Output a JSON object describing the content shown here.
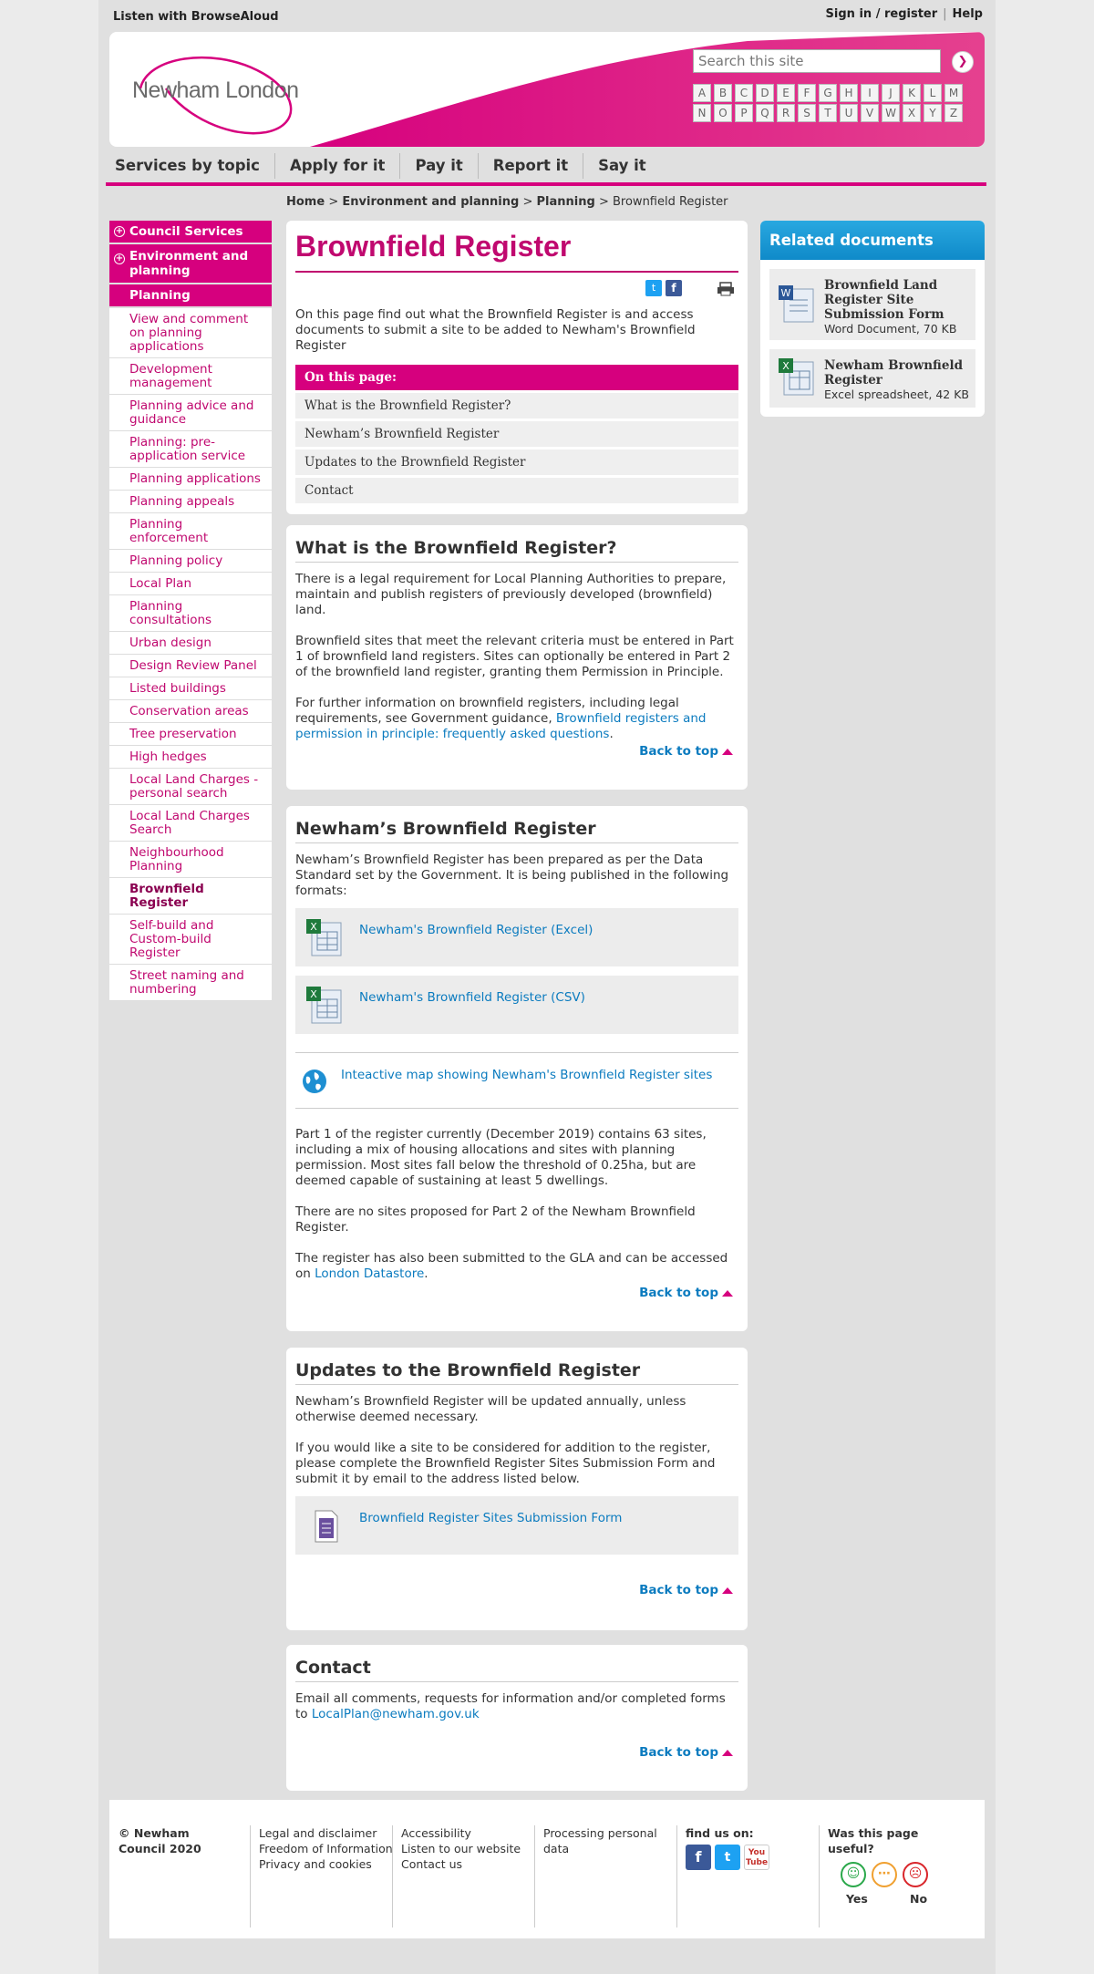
{
  "topbar": {
    "browsealoud": "Listen with BrowseAloud",
    "signin": "Sign in / register",
    "help": "Help"
  },
  "header": {
    "logo_text": "Newham London",
    "search_placeholder": "Search this site",
    "az_row1": [
      "A",
      "B",
      "C",
      "D",
      "E",
      "F",
      "G",
      "H",
      "I",
      "J",
      "K",
      "L",
      "M"
    ],
    "az_row2": [
      "N",
      "O",
      "P",
      "Q",
      "R",
      "S",
      "T",
      "U",
      "V",
      "W",
      "X",
      "Y",
      "Z"
    ]
  },
  "nav": [
    "Services by topic",
    "Apply for it",
    "Pay it",
    "Report it",
    "Say it"
  ],
  "breadcrumb": {
    "home": "Home",
    "env": "Environment and planning",
    "planning": "Planning",
    "current": "Brownfield Register",
    "sep": ">"
  },
  "sidebar": {
    "heads": [
      "Council Services",
      "Environment and planning"
    ],
    "section": "Planning",
    "items": [
      "View and comment on planning applications",
      "Development management",
      "Planning advice and guidance",
      "Planning: pre-application service",
      "Planning applications",
      "Planning appeals",
      "Planning enforcement",
      "Planning policy",
      "Local Plan",
      "Planning consultations",
      "Urban design",
      "Design Review Panel",
      "Listed buildings",
      "Conservation areas",
      "Tree preservation",
      "High hedges",
      "Local Land Charges - personal search",
      "Local Land Charges Search",
      "Neighbourhood Planning",
      "Brownfield Register",
      "Self-build and Custom-build Register",
      "Street naming and numbering"
    ]
  },
  "intro": {
    "title": "Brownfield Register",
    "text": "On this page find out what the Brownfield Register is and access documents to submit a site to be added to Newham's Brownfield Register",
    "on_this_page": "On this page:",
    "links": [
      "What is the Brownfield Register?",
      "Newham’s Brownfield Register",
      "Updates to the Brownfield Register",
      "Contact"
    ]
  },
  "what": {
    "heading": "What is the Brownfield Register?",
    "p1": "There is a legal requirement for Local Planning Authorities to prepare, maintain and publish registers of previously developed (brownfield) land.",
    "p2": "Brownfield sites that meet the relevant criteria must be entered in Part 1 of brownfield land registers. Sites can optionally be entered in Part 2 of the brownfield land register, granting them Permission in Principle.",
    "p3_pre": "For further information on brownfield registers, including legal requirements, see Government guidance, ",
    "p3_link": "Brownfield registers and permission in principle: frequently asked questions",
    "p3_post": "."
  },
  "newham": {
    "heading": "Newham’s Brownfield Register",
    "p1": "Newham’s Brownfield Register has been prepared as per the Data Standard set by the Government. It is being published in the following formats:",
    "doc_excel": "Newham's Brownfield Register (Excel)",
    "doc_csv": "Newham's Brownfield Register (CSV)",
    "map_link": "Inteactive map showing Newham's Brownfield Register sites",
    "p2": "Part 1 of the register currently (December 2019) contains 63 sites, including a mix of housing allocations and sites with planning permission. Most sites fall below the threshold of 0.25ha, but are deemed capable of sustaining at least 5 dwellings.",
    "p3": "There are no sites proposed for Part 2 of the Newham Brownfield Register.",
    "p4_pre": "The register has also been submitted to the GLA and can be accessed on ",
    "p4_link": "London Datastore",
    "p4_post": "."
  },
  "updates": {
    "heading": "Updates to the Brownfield Register",
    "p1": "Newham’s Brownfield Register will be updated annually, unless otherwise deemed necessary.",
    "p2": "If you would like a site to be considered for addition to the register, please complete the Brownfield Register Sites Submission Form and submit it by email to the address listed below.",
    "doc": "Brownfield Register Sites Submission Form"
  },
  "contact": {
    "heading": "Contact",
    "p_pre": "Email all comments, requests for information and/or completed forms to ",
    "email": "LocalPlan@newham.gov.uk"
  },
  "back_to_top": "Back to top",
  "related": {
    "heading": "Related documents",
    "items": [
      {
        "title": "Brownfield Land Register Site Submission Form",
        "meta": "Word Document, 70 KB"
      },
      {
        "title": "Newham Brownfield Register",
        "meta": "Excel spreadsheet, 42 KB"
      }
    ]
  },
  "footer": {
    "copyright": "© Newham Council 2020",
    "col2": [
      "Legal and disclaimer",
      "Freedom of Information",
      "Privacy and cookies"
    ],
    "col3": [
      "Accessibility",
      "Listen to our website",
      "Contact us"
    ],
    "col4": "Processing personal data",
    "find_us": "find us on:",
    "useful": "Was this page useful?",
    "yes": "Yes",
    "no": "No"
  },
  "colors": {
    "brand_pink": "#d6007e",
    "link_blue": "#0b7bbf",
    "related_blue": "#1a96d4"
  }
}
